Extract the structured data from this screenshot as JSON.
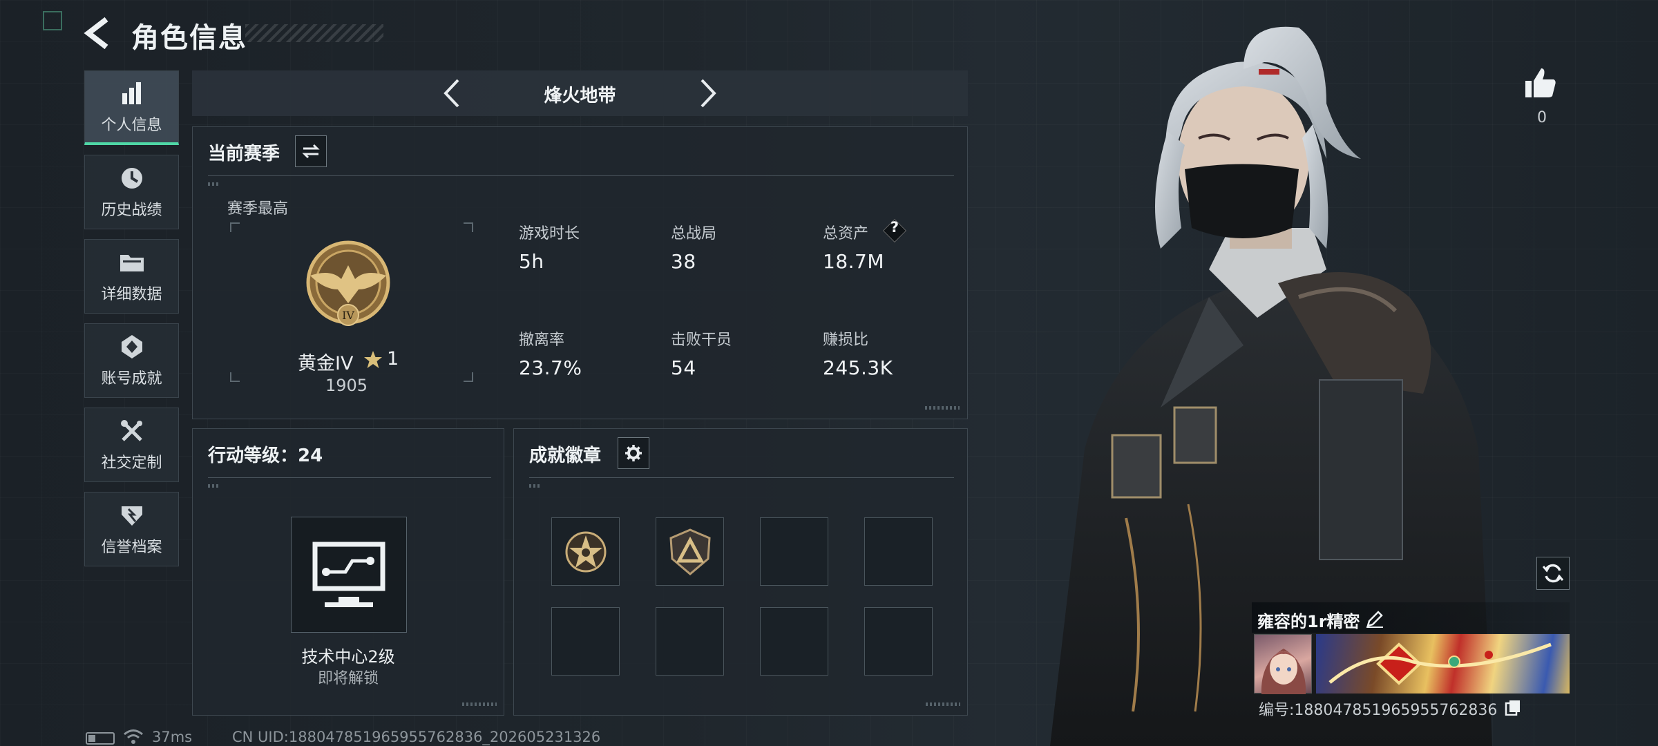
{
  "header": {
    "title": "角色信息"
  },
  "sidebar": {
    "items": [
      {
        "label": "个人信息",
        "icon": "bar-chart-icon",
        "active": true
      },
      {
        "label": "历史战绩",
        "icon": "history-icon"
      },
      {
        "label": "详细数据",
        "icon": "folder-icon"
      },
      {
        "label": "账号成就",
        "icon": "achievement-icon"
      },
      {
        "label": "社交定制",
        "icon": "tools-icon"
      },
      {
        "label": "信誉档案",
        "icon": "credit-icon"
      }
    ]
  },
  "mode_tab": {
    "name": "烽火地带"
  },
  "season": {
    "title": "当前赛季",
    "best_label": "赛季最高",
    "rank_name": "黄金IV",
    "rank_stars": "1",
    "rank_score": "1905",
    "rank_emblem_text": "IV",
    "stats": [
      {
        "label": "游戏时长",
        "value": "5h"
      },
      {
        "label": "总战局",
        "value": "38"
      },
      {
        "label": "总资产",
        "value": "18.7M",
        "help": "?"
      },
      {
        "label": "撤离率",
        "value": "23.7%"
      },
      {
        "label": "击败干员",
        "value": "54"
      },
      {
        "label": "赚损比",
        "value": "245.3K"
      }
    ]
  },
  "action_level": {
    "title": "行动等级：24",
    "unlock_name": "技术中心2级",
    "unlock_status": "即将解锁"
  },
  "badges": {
    "title": "成就徽章"
  },
  "player": {
    "name": "雍容的1r精密",
    "id_text": "编号:18804785196595576​2836",
    "likes": "0"
  },
  "footer": {
    "ping": "37ms",
    "uid": "CN UID:18804785196595576​2836_202605231326"
  },
  "colors": {
    "accent": "#4fd7a6",
    "panel": "#20272e",
    "border": "#3e4850"
  }
}
